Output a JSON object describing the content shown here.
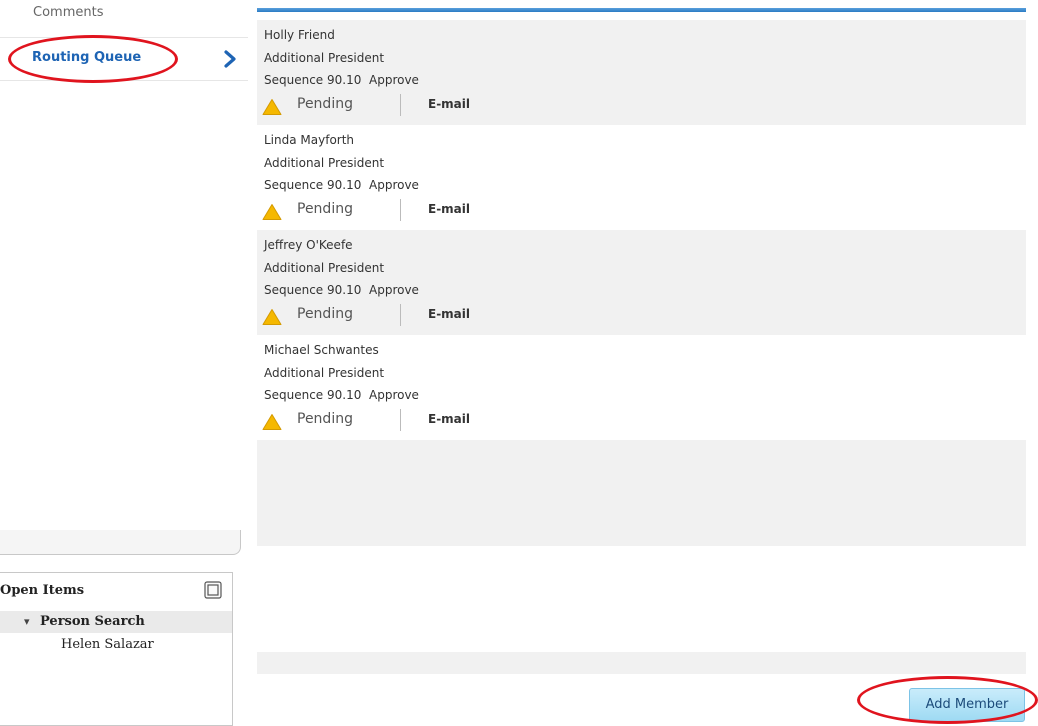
{
  "nav": {
    "comments_label": "Comments",
    "routing_queue_label": "Routing Queue",
    "accent_color": "#1e64b4"
  },
  "open_items": {
    "title": "Open Items",
    "group_label": "Person Search",
    "items": [
      "Helen Salazar"
    ]
  },
  "queue": [
    {
      "name": "Holly Friend",
      "role": "Additional President",
      "sequence": "Sequence 90.10",
      "action": "Approve",
      "status": "Pending",
      "contact": "E-mail"
    },
    {
      "name": "Linda Mayforth",
      "role": "Additional President",
      "sequence": "Sequence 90.10",
      "action": "Approve",
      "status": "Pending",
      "contact": "E-mail"
    },
    {
      "name": "Jeffrey O'Keefe",
      "role": "Additional President",
      "sequence": "Sequence 90.10",
      "action": "Approve",
      "status": "Pending",
      "contact": "E-mail"
    },
    {
      "name": "Michael Schwantes",
      "role": "Additional President",
      "sequence": "Sequence 90.10",
      "action": "Approve",
      "status": "Pending",
      "contact": "E-mail"
    }
  ],
  "actions": {
    "add_member_label": "Add Member"
  },
  "icons": {
    "status": "warning-triangle-icon",
    "nav": "chevron-right-icon",
    "panel": "maximize-icon"
  },
  "colors": {
    "annotation": "#e0141e",
    "warning": "#f5b800",
    "button": "#9edaf3"
  }
}
